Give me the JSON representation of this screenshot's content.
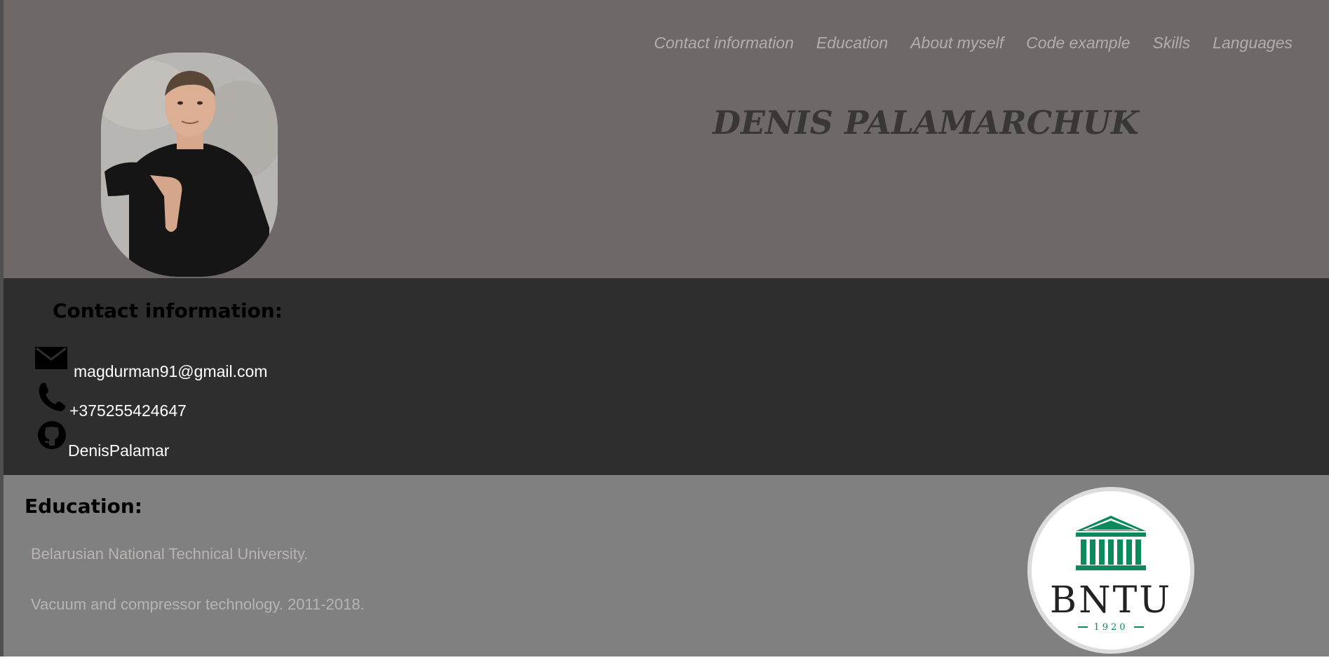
{
  "nav": {
    "items": [
      "Contact information",
      "Education",
      "About myself",
      "Code example",
      "Skills",
      "Languages"
    ]
  },
  "header": {
    "name": "DENIS PALAMARCHUK",
    "photo_icon": "profile-photo"
  },
  "contact": {
    "title": "Contact information:",
    "email": "magdurman91@gmail.com",
    "phone": "+375255424647",
    "github": "DenisPalamar",
    "icons": [
      "envelope-icon",
      "phone-icon",
      "github-icon"
    ]
  },
  "education": {
    "title": "Education:",
    "university": "Belarusian National Technical University.",
    "specialty": "Vacuum and compressor technology. 2011-2018.",
    "logo": {
      "text": "BNTU",
      "year": "1920",
      "color": "#0b8a5c"
    }
  },
  "colors": {
    "header_bg": "#6e6868",
    "contact_bg": "#2e2e2e",
    "education_bg": "#808080",
    "nav_text": "#b3adad"
  }
}
